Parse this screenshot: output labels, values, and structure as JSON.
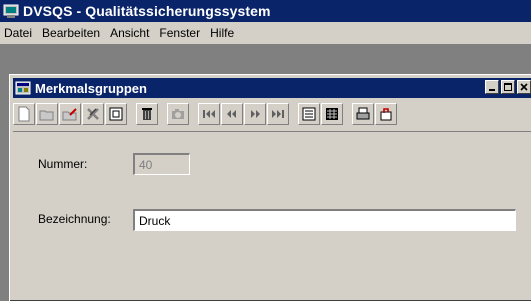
{
  "app": {
    "title": "DVSQS - Qualitätssicherungssystem"
  },
  "menu": [
    "Datei",
    "Bearbeiten",
    "Ansicht",
    "Fenster",
    "Hilfe"
  ],
  "child": {
    "title": "Merkmalsgruppen",
    "window_buttons": [
      "minimize-icon",
      "restore-icon",
      "close-icon"
    ]
  },
  "toolbar": {
    "buttons": [
      "new-doc-icon",
      "open-folder-icon",
      "edit-folder-icon",
      "delete-x-icon",
      "copy-icon",
      "trash-icon",
      "camera-icon",
      "first-record-icon",
      "prev-record-icon",
      "next-record-icon",
      "last-record-icon",
      "list-view-icon",
      "table-view-icon",
      "print-icon",
      "exit-icon"
    ]
  },
  "form": {
    "nummer_label": "Nummer:",
    "nummer_value": "40",
    "bezeichnung_label": "Bezeichnung:",
    "bezeichnung_value": "Druck"
  },
  "colors": {
    "titlebar": "#0a246a",
    "face": "#d4d0c8",
    "desktop": "#808080"
  }
}
